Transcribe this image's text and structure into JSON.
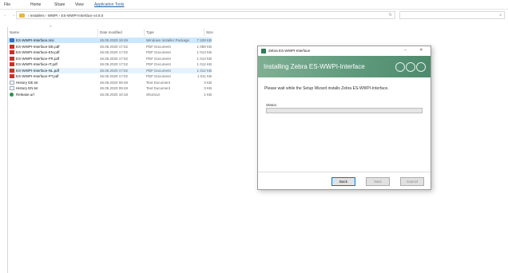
{
  "explorer": {
    "ribbon_tabs": [
      "File",
      "Home",
      "Share",
      "View",
      "Application Tools"
    ],
    "ribbon_active": 4,
    "nav": "← → ↑",
    "breadcrumb": "› Installers › WWPI › ES-WWPI-Interface v4.6.0",
    "search_placeholder": "",
    "columns": {
      "name": "Name",
      "date": "Date modified",
      "type": "Type",
      "size": "Size"
    },
    "files": [
      {
        "name": "ES-WWPI-Interface.msi",
        "date": "26.05.2020 18:49",
        "type": "Windows Installer Package",
        "size": "7 429 KB",
        "icon": "setup",
        "state": "selected"
      },
      {
        "name": "ES-WWPI-Interface-DE.pdf",
        "date": "26.05.2020 17:02",
        "type": "PDF Document",
        "size": "1 059 KB",
        "icon": "pdf",
        "state": ""
      },
      {
        "name": "ES-WWPI-Interface-EN.pdf",
        "date": "26.05.2020 17:02",
        "type": "PDF Document",
        "size": "1 013 KB",
        "icon": "pdf",
        "state": ""
      },
      {
        "name": "ES-WWPI-Interface-FR.pdf",
        "date": "26.05.2020 17:02",
        "type": "PDF Document",
        "size": "1 013 KB",
        "icon": "pdf",
        "state": ""
      },
      {
        "name": "ES-WWPI-Interface-IT.pdf",
        "date": "26.05.2020 17:02",
        "type": "PDF Document",
        "size": "1 012 KB",
        "icon": "pdf",
        "state": ""
      },
      {
        "name": "ES-WWPI-Interface-NL.pdf",
        "date": "26.05.2020 17:02",
        "type": "PDF Document",
        "size": "1 012 KB",
        "icon": "pdf",
        "state": "hover"
      },
      {
        "name": "ES-WWPI-Interface-PT.pdf",
        "date": "26.05.2020 17:02",
        "type": "PDF Document",
        "size": "1 011 KB",
        "icon": "pdf",
        "state": ""
      },
      {
        "name": "History DE.txt",
        "date": "26.05.2020 09:49",
        "type": "Text Document",
        "size": "3 KB",
        "icon": "txt",
        "state": ""
      },
      {
        "name": "History EN.txt",
        "date": "26.05.2020 09:49",
        "type": "Text Document",
        "size": "3 KB",
        "icon": "txt",
        "state": ""
      },
      {
        "name": "Release.url",
        "date": "26.05.2020 10:18",
        "type": "Shortcut",
        "size": "1 KB",
        "icon": "link",
        "state": ""
      }
    ]
  },
  "dialog": {
    "title": "Zebra ES-WWPI-Interface",
    "minimize": "–",
    "close": "✕",
    "banner_title": "Installing Zebra ES-WWPI-Interface",
    "status": "Please wait while the Setup Wizard installs Zebra ES-WWPI-Interface.",
    "status_label": "Status:",
    "progress": 0,
    "buttons": {
      "back": "Back",
      "next": "Next",
      "cancel": "Cancel"
    }
  },
  "colors": {
    "accent": "#0078d7",
    "banner": "#5f9a7d",
    "selected_row": "#cce8ff",
    "progress": "#06b025"
  }
}
